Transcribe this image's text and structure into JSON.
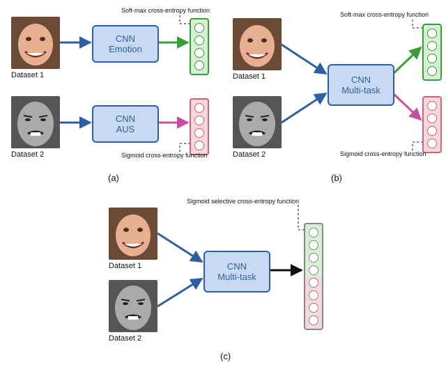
{
  "panelA": {
    "dataset1": "Dataset 1",
    "dataset2": "Dataset 2",
    "box1": "CNN\nEmotion",
    "box2": "CNN\nAUS",
    "loss1": "Soft-max cross-entropy function",
    "loss2": "Sigmoid cross-entropy function",
    "label": "(a)"
  },
  "panelB": {
    "dataset1": "Dataset 1",
    "dataset2": "Dataset 2",
    "box": "CNN\nMulti-task",
    "loss1": "Soft-max cross-entropy function",
    "loss2": "Sigmoid cross-entropy function",
    "label": "(b)"
  },
  "panelC": {
    "dataset1": "Dataset 1",
    "dataset2": "Dataset 2",
    "box": "CNN\nMulti-task",
    "loss": "Sigmoid selective cross-entropy function",
    "label": "(c)"
  }
}
